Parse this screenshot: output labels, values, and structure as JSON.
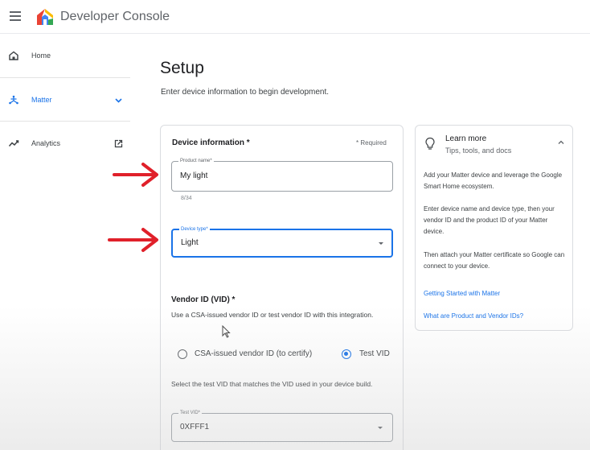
{
  "app": {
    "title": "Developer Console"
  },
  "sidebar": {
    "items": [
      {
        "label": "Home",
        "icon": "home-icon"
      },
      {
        "label": "Matter",
        "icon": "matter-icon",
        "active": true
      },
      {
        "label": "Analytics",
        "icon": "analytics-icon"
      }
    ]
  },
  "page": {
    "title": "Setup",
    "subtitle": "Enter device information to begin development."
  },
  "device_info": {
    "heading": "Device information *",
    "required_note": "* Required",
    "product_name": {
      "label": "Product name*",
      "value": "My light",
      "counter": "8/34"
    },
    "device_type": {
      "label": "Device type*",
      "value": "Light"
    }
  },
  "vendor": {
    "heading": "Vendor ID (VID) *",
    "description": "Use a CSA-issued vendor ID or test vendor ID with this integration.",
    "option_csa": "CSA-issued vendor ID (to certify)",
    "option_test": "Test VID",
    "selected": "Test VID",
    "test_help": "Select the test VID that matches the VID used in your device build.",
    "test_vid": {
      "label": "Test VID*",
      "value": "0XFFF1"
    }
  },
  "learn_more": {
    "title": "Learn more",
    "subtitle": "Tips, tools, and docs",
    "para1": "Add your Matter device and leverage the Google Smart Home ecosystem.",
    "para2": "Enter device name and device type, then your vendor ID and the product ID of your Matter device.",
    "para3": "Then attach your Matter certificate so Google can connect to your device.",
    "link1": "Getting Started with Matter",
    "link2": "What are Product and Vendor IDs?"
  },
  "colors": {
    "accent": "#1a73e8",
    "annotation_arrow": "#e0202a",
    "border": "#dadce0"
  }
}
